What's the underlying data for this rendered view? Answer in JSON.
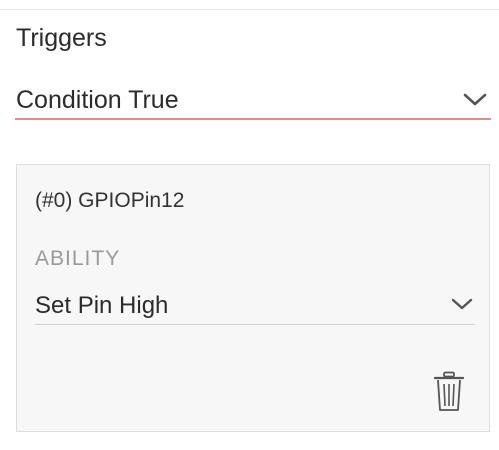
{
  "triggers": {
    "title": "Triggers",
    "selected": "Condition True",
    "chevron_icon": "chevron-down-icon",
    "underline_color": "#e88a82"
  },
  "device_card": {
    "name": "(#0) GPIOPin12",
    "ability_label": "ABILITY",
    "ability_selected": "Set Pin High",
    "chevron_icon": "chevron-down-icon",
    "delete_icon": "trash-icon"
  }
}
